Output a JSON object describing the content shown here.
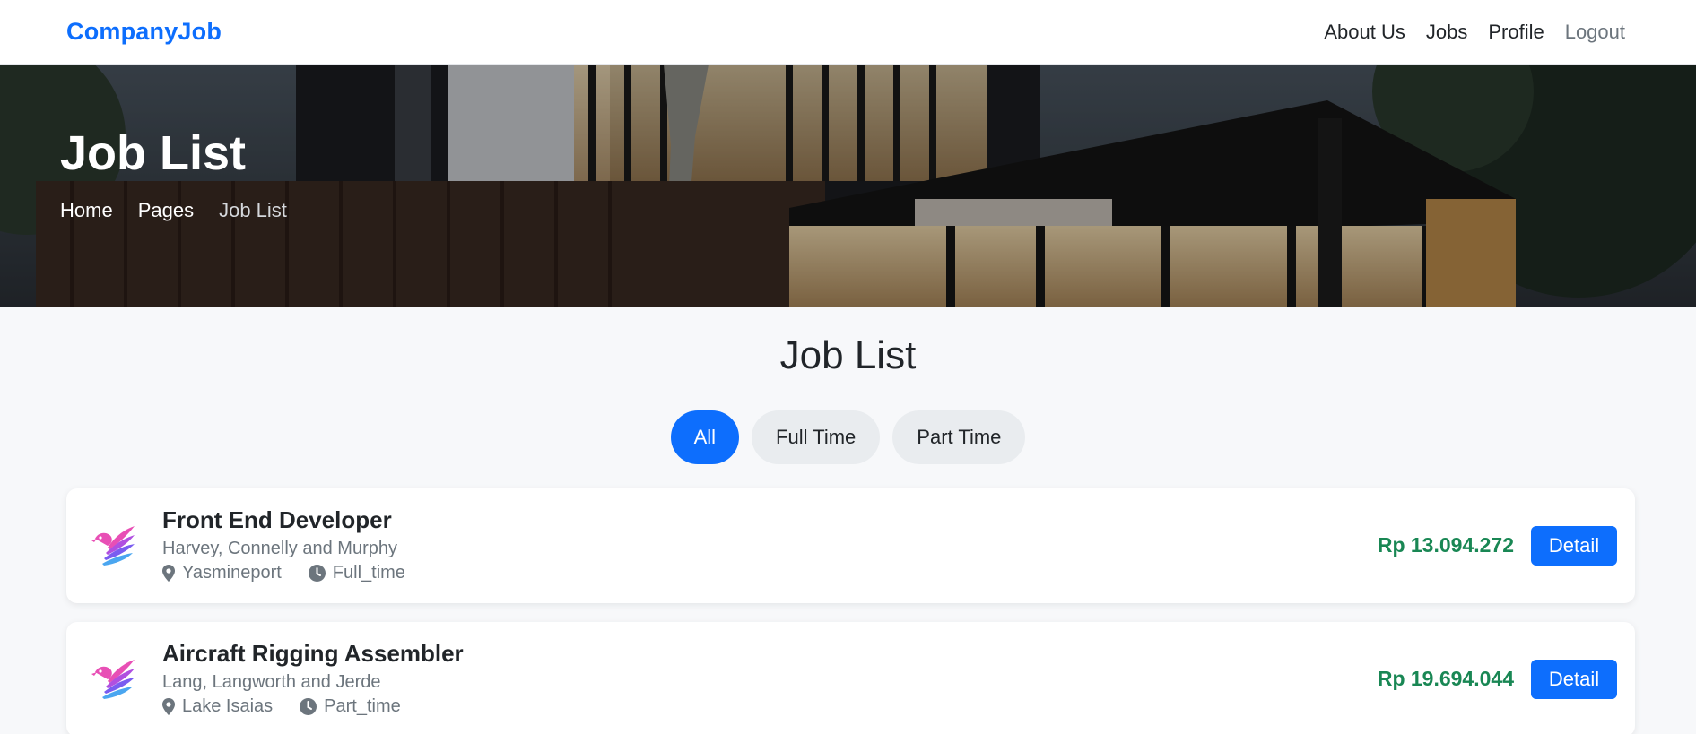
{
  "navbar": {
    "brand": "CompanyJob",
    "links": [
      {
        "label": "About Us"
      },
      {
        "label": "Jobs"
      },
      {
        "label": "Profile"
      },
      {
        "label": "Logout"
      }
    ]
  },
  "hero": {
    "title": "Job List",
    "breadcrumb": [
      "Home",
      "Pages",
      "Job List"
    ]
  },
  "section": {
    "title": "Job List"
  },
  "filters": {
    "options": [
      "All",
      "Full Time",
      "Part Time"
    ],
    "selected": "All"
  },
  "jobs": [
    {
      "title": "Front End Developer",
      "company": "Harvey, Connelly and Murphy",
      "location": "Yasmineport",
      "type": "Full_time",
      "salary": "Rp 13.094.272",
      "action": "Detail"
    },
    {
      "title": "Aircraft Rigging Assembler",
      "company": "Lang, Langworth and Jerde",
      "location": "Lake Isaias",
      "type": "Part_time",
      "salary": "Rp 19.694.044",
      "action": "Detail"
    }
  ],
  "colors": {
    "brand": "#0d6efd",
    "salary": "#198754",
    "button": "#0d6efd"
  },
  "icons": {
    "location": "map-pin-icon",
    "type": "clock-icon",
    "company_logo": "bird-logo-icon"
  }
}
